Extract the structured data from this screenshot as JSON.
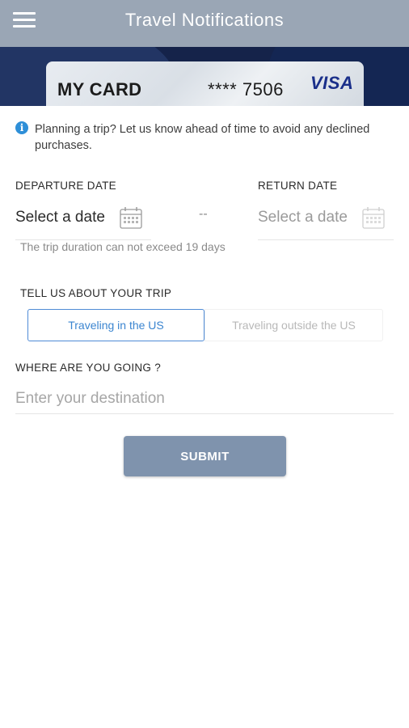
{
  "header": {
    "title": "Travel Notifications",
    "menu_icon": "hamburger-menu-icon"
  },
  "card": {
    "name": "MY CARD",
    "masked_number": "**** 7506",
    "brand": "VISA",
    "brand_color": "#1a2f8a"
  },
  "info": {
    "icon": "info-icon",
    "text": "Planning a trip? Let us know ahead of time to avoid any declined purchases."
  },
  "dates": {
    "departure_label": "DEPARTURE DATE",
    "departure_value": "Select a date",
    "separator": "--",
    "return_label": "RETURN DATE",
    "return_value": "Select a date",
    "calendar_icon": "calendar-icon",
    "duration_hint": "The trip duration can not exceed 19 days"
  },
  "trip_type": {
    "label": "TELL US ABOUT YOUR TRIP",
    "options": [
      "Traveling in the US",
      "Traveling outside the US"
    ],
    "selected": "Traveling in the US"
  },
  "destination": {
    "label": "WHERE ARE YOU GOING ?",
    "placeholder": "Enter your destination",
    "value": ""
  },
  "submit": {
    "label": "SUBMIT"
  },
  "colors": {
    "header_bg": "#9aa6b5",
    "banner_bg": "#15234a",
    "accent": "#3b85d0",
    "submit_bg": "#7f93ad"
  }
}
